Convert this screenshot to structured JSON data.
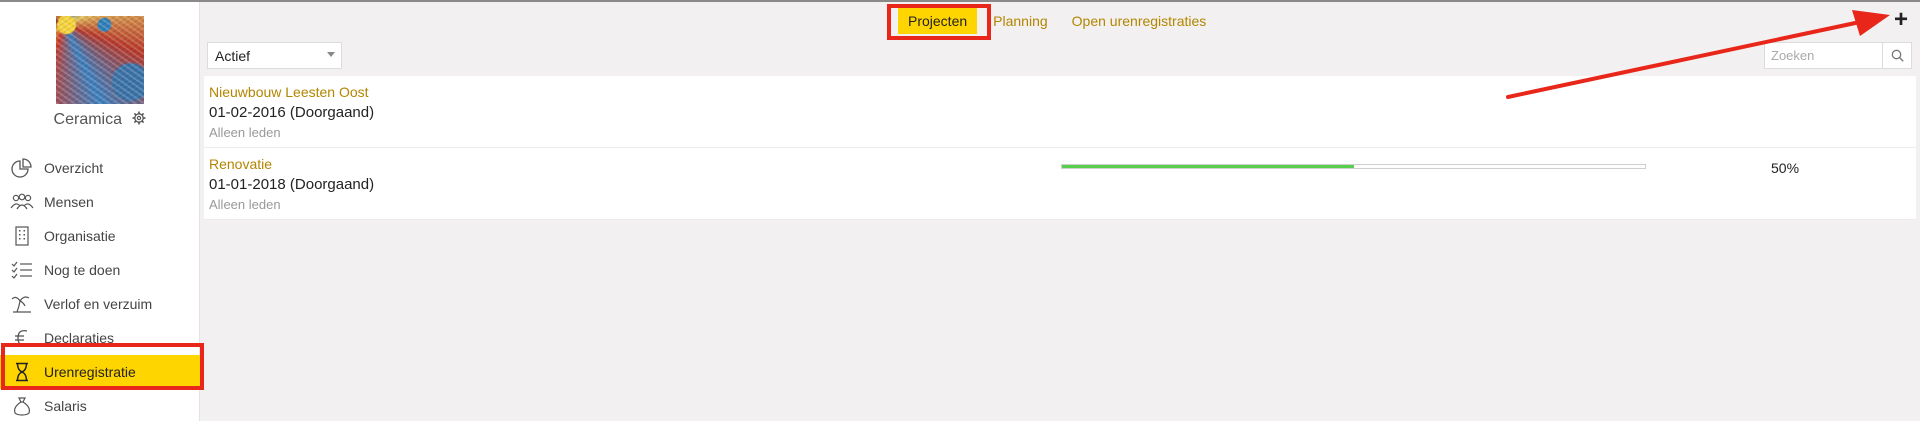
{
  "sidebar": {
    "company_name": "Ceramica",
    "items": [
      {
        "label": "Overzicht",
        "icon": "pie-chart-icon"
      },
      {
        "label": "Mensen",
        "icon": "people-icon"
      },
      {
        "label": "Organisatie",
        "icon": "building-icon"
      },
      {
        "label": "Nog te doen",
        "icon": "checklist-icon"
      },
      {
        "label": "Verlof en verzuim",
        "icon": "palm-tree-icon"
      },
      {
        "label": "Declaraties",
        "icon": "euro-icon"
      },
      {
        "label": "Urenregistratie",
        "icon": "hourglass-icon",
        "active": true
      },
      {
        "label": "Salaris",
        "icon": "money-bag-icon"
      }
    ]
  },
  "tabs": [
    {
      "label": "Projecten",
      "active": true
    },
    {
      "label": "Planning"
    },
    {
      "label": "Open urenregistraties"
    }
  ],
  "toolbar": {
    "add_label": "+",
    "filter_value": "Actief",
    "search_placeholder": "Zoeken"
  },
  "projects": [
    {
      "name": "Nieuwbouw Leesten Oost",
      "date": "01-02-2016 (Doorgaand)",
      "access": "Alleen leden"
    },
    {
      "name": "Renovatie",
      "date": "01-01-2018 (Doorgaand)",
      "access": "Alleen leden",
      "progress": 0.5,
      "progress_label": "50%"
    }
  ],
  "colors": {
    "accent": "#ffd500",
    "link": "#b38600",
    "highlight": "#e8261a",
    "progress": "#58d04e"
  }
}
